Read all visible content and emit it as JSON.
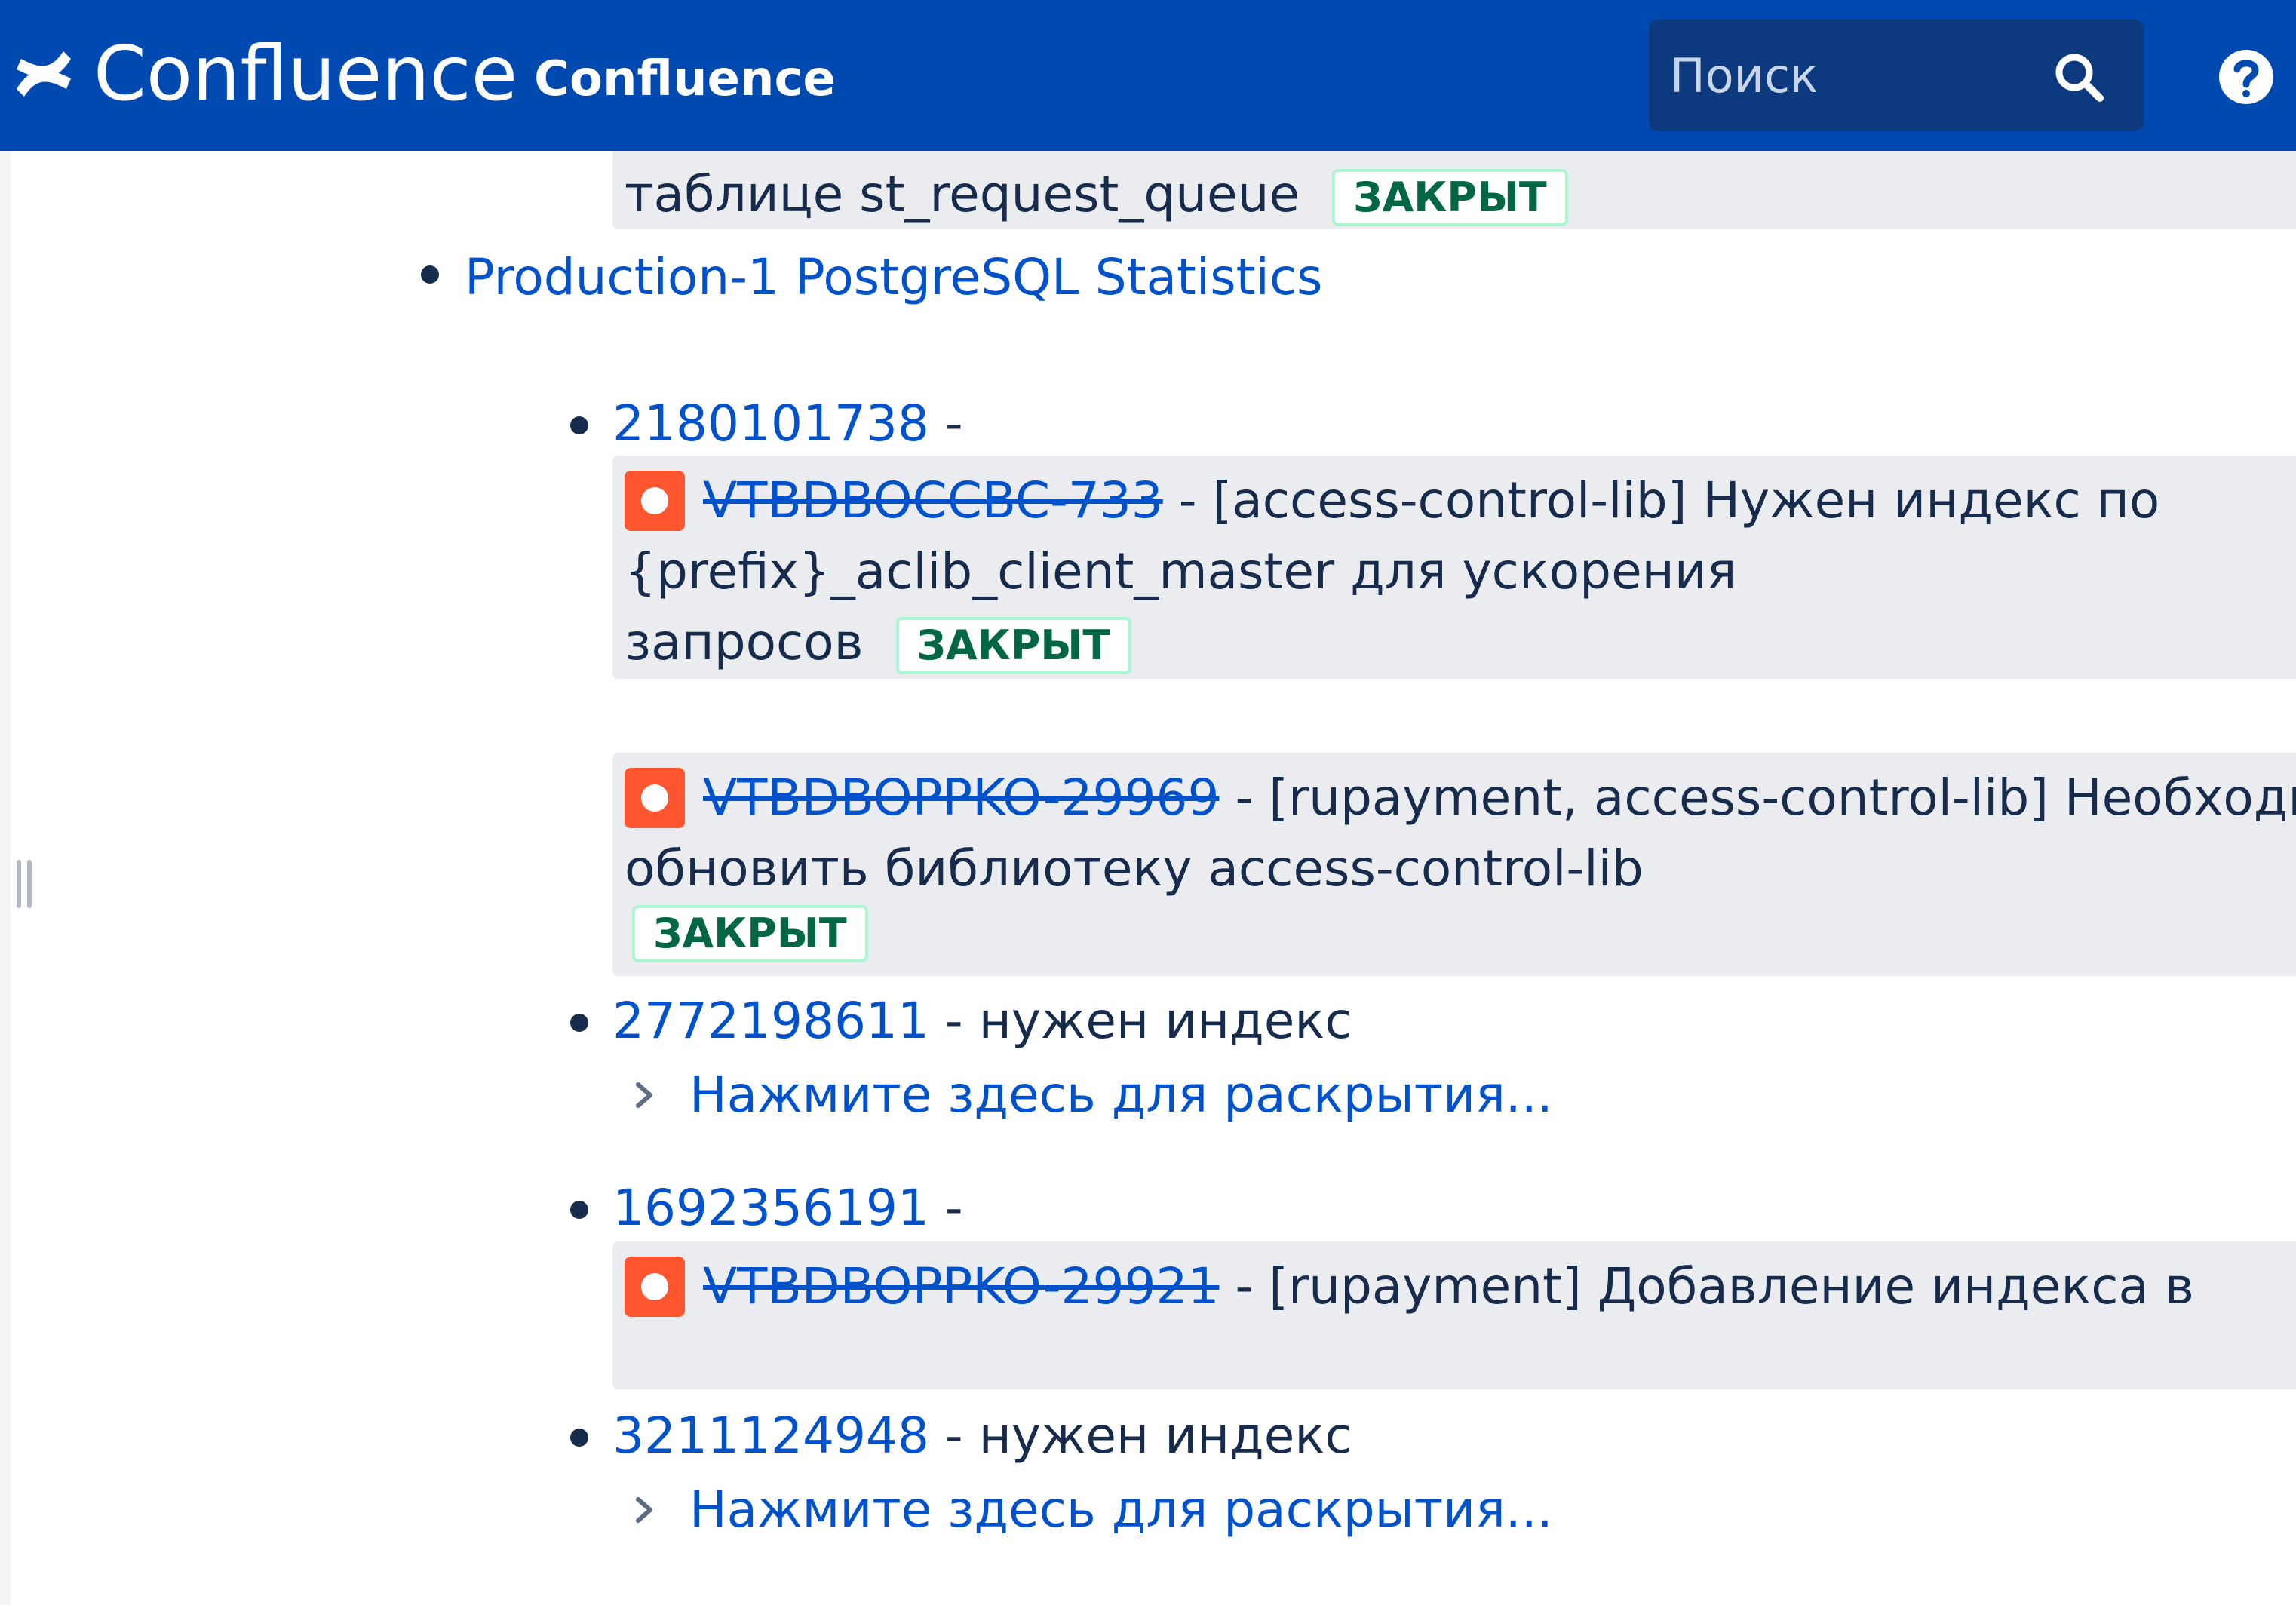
{
  "header": {
    "product_name": "Confluence",
    "space_name": "Confluence",
    "search_placeholder": "Поиск"
  },
  "top_panel": {
    "text": "таблице st_request_queue",
    "status": "ЗАКРЫТ"
  },
  "list": {
    "statistics_link": "Production-1 PostgreSQL Statistics",
    "items": [
      {
        "id": "2180101738",
        "suffix": " -",
        "issues": [
          {
            "key": "VTBDBOCCBC-733",
            "line1": " - [access-control-lib] Нужен индекс по",
            "line2": "{prefix}_aclib_client_master для ускорения",
            "line3": "запросов",
            "status": "ЗАКРЫТ"
          },
          {
            "key": "VTBDBOPPKO-29969",
            "line1": " - [rupayment, access-control-lib] Необходимо",
            "line2": "обновить библиотеку access-control-lib",
            "status": "ЗАКРЫТ"
          }
        ]
      },
      {
        "id": "2772198611",
        "suffix": " - нужен индекс",
        "expand": "Нажмите здесь для раскрытия..."
      },
      {
        "id": "1692356191",
        "suffix": " -",
        "issues": [
          {
            "key": "VTBDBOPPKO-29921",
            "line1": " - [rupayment] Добавление индекса в"
          }
        ]
      },
      {
        "id": "3211124948",
        "suffix": " - нужен индекс",
        "expand": "Нажмите здесь для раскрытия..."
      }
    ]
  },
  "colors": {
    "header_bg": "#0049b0",
    "link": "#0052cc",
    "status_green": "#006644",
    "jira_icon": "#ff5630",
    "panel_bg": "#ebecf0"
  }
}
